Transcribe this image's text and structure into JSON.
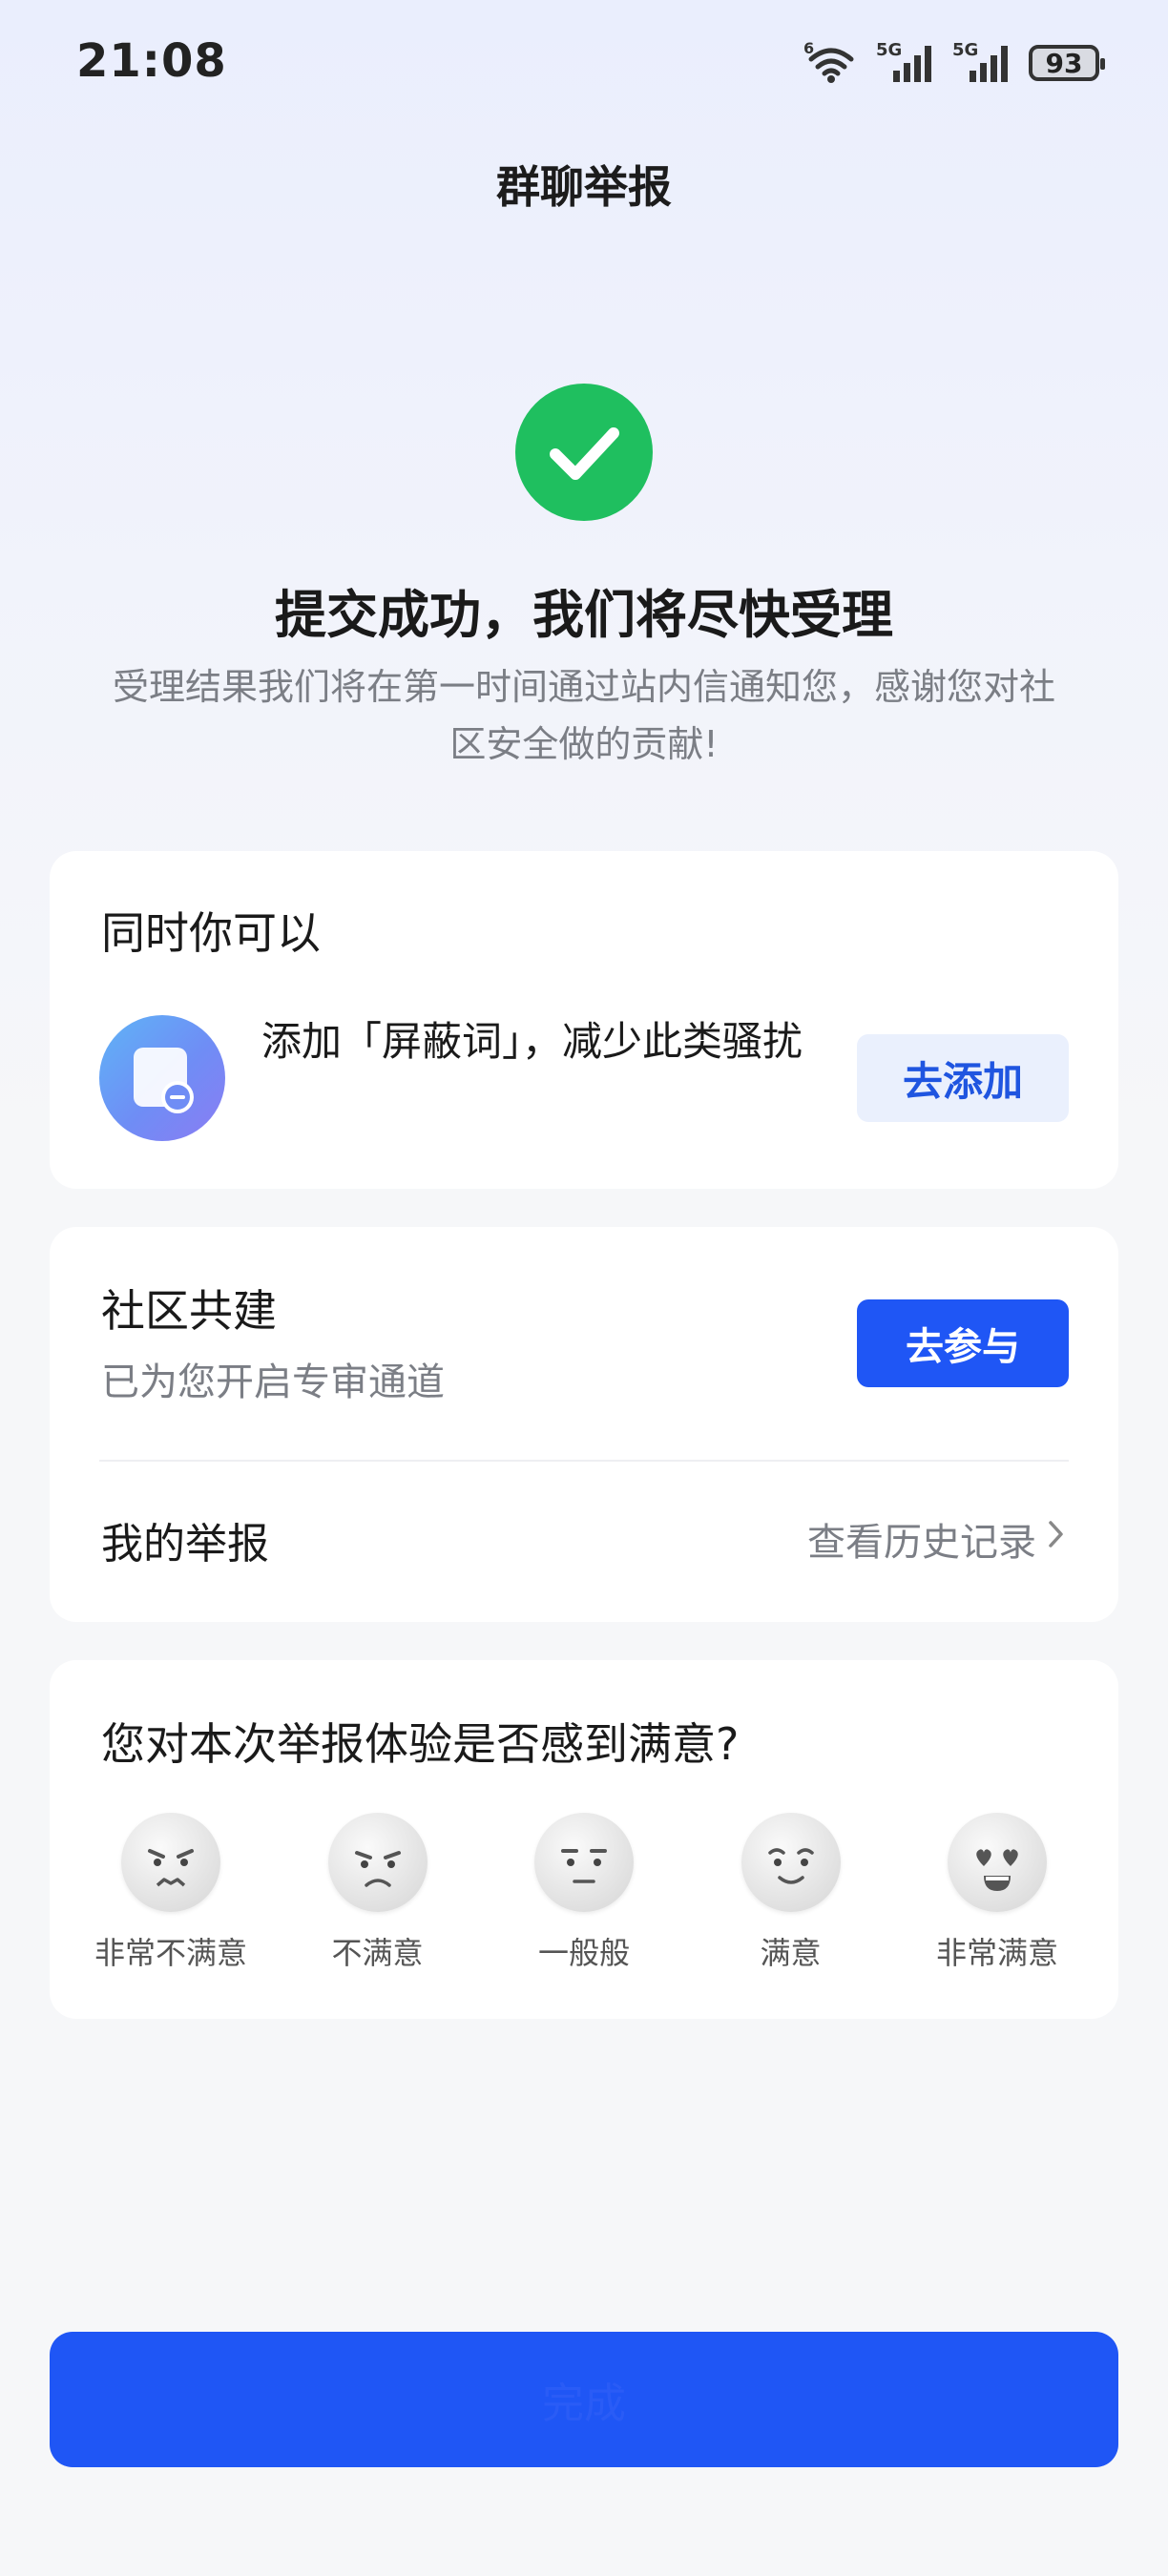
{
  "status_bar": {
    "time": "21:08",
    "wifi_badge": "6",
    "sim1_label": "5G",
    "sim2_label": "5G",
    "battery": "93",
    "icons": [
      "wifi-icon",
      "signal-icon",
      "signal-icon",
      "battery-icon"
    ]
  },
  "header": {
    "title": "群聊举报"
  },
  "result": {
    "icon": "check-circle-icon",
    "title": "提交成功，我们将尽快受理",
    "message": "受理结果我们将在第一时间通过站内信通知您，感谢您对社区安全做的贡献!"
  },
  "suggestion_card": {
    "heading": "同时你可以",
    "item_icon": "block-word-icon",
    "item_text": "添加「屏蔽词」，减少此类骚扰",
    "action_label": "去添加"
  },
  "community_card": {
    "title": "社区共建",
    "subtitle": "已为您开启专审通道",
    "action_label": "去参与",
    "my_reports_label": "我的举报",
    "history_link": "查看历史记录"
  },
  "survey_card": {
    "question": "您对本次举报体验是否感到满意?",
    "options": [
      {
        "label": "非常不满意",
        "icon": "very-unsatisfied-face-icon"
      },
      {
        "label": "不满意",
        "icon": "unsatisfied-face-icon"
      },
      {
        "label": "一般般",
        "icon": "neutral-face-icon"
      },
      {
        "label": "满意",
        "icon": "satisfied-face-icon"
      },
      {
        "label": "非常满意",
        "icon": "very-satisfied-face-icon"
      }
    ]
  },
  "footer": {
    "button_label": "完成"
  },
  "colors": {
    "primary": "#1f56f5",
    "success": "#1fbf5f",
    "light_button": "#eaf0fd"
  }
}
